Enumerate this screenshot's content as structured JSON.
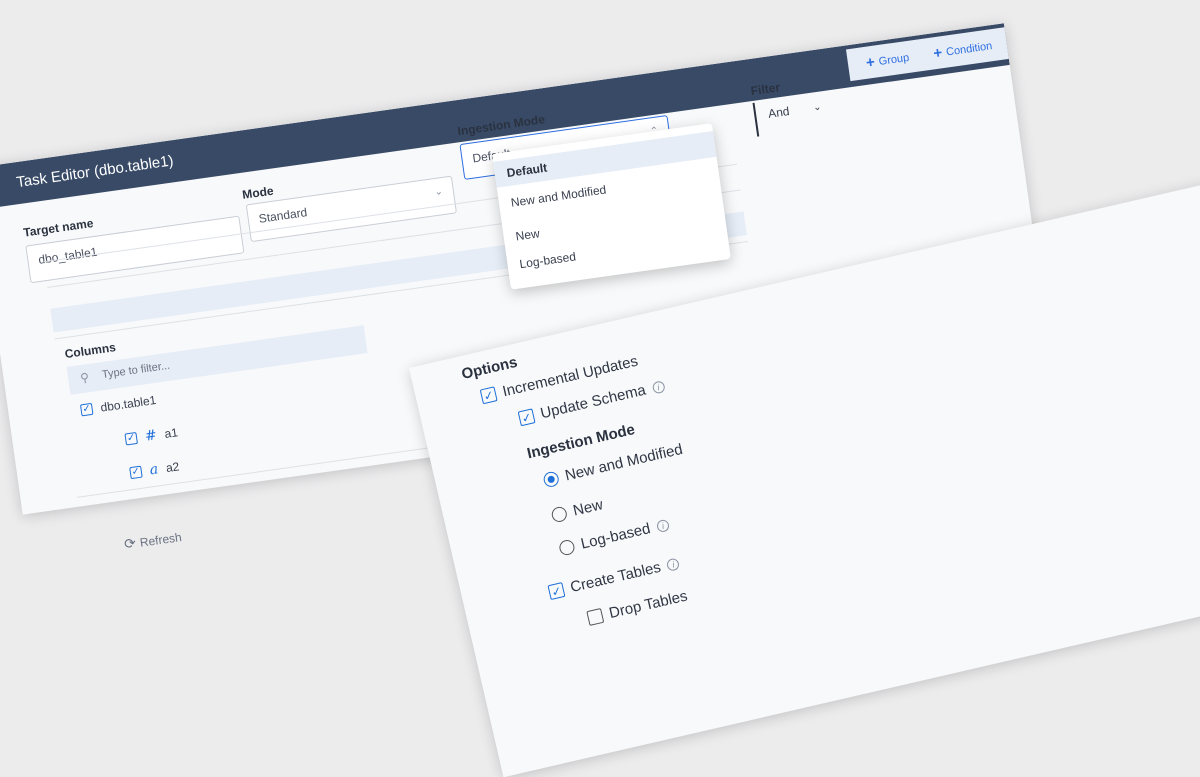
{
  "editor": {
    "title": "Task Editor (dbo.table1)",
    "target_name": {
      "label": "Target name",
      "value": "dbo_table1"
    },
    "mode": {
      "label": "Mode",
      "value": "Standard"
    },
    "ingestion_mode": {
      "label": "Ingestion Mode",
      "value": "Default",
      "options": [
        "Default",
        "New and Modified",
        "New",
        "Log-based"
      ],
      "selected_option": "Default"
    },
    "filter": {
      "label": "Filter",
      "operator": "And",
      "add_group": "Group",
      "add_condition": "Condition"
    },
    "columns": {
      "label": "Columns",
      "filter_placeholder": "Type to filter...",
      "table": "dbo.table1",
      "items": [
        {
          "name": "a1",
          "type_icon": "hash-icon",
          "type_glyph": "#"
        },
        {
          "name": "a2",
          "type_icon": "text-icon",
          "type_glyph": "a"
        }
      ]
    },
    "refresh": "Refresh"
  },
  "options": {
    "heading": "Options",
    "incremental_updates": "Incremental Updates",
    "update_schema": "Update Schema",
    "ingestion_heading": "Ingestion Mode",
    "radio": {
      "new_and_modified": "New and Modified",
      "new": "New",
      "log_based": "Log-based"
    },
    "create_tables": "Create Tables",
    "drop_tables": "Drop Tables"
  },
  "colors": {
    "header": "#384a66",
    "accent": "#1e6fd9",
    "highlight": "#e6edf7"
  }
}
